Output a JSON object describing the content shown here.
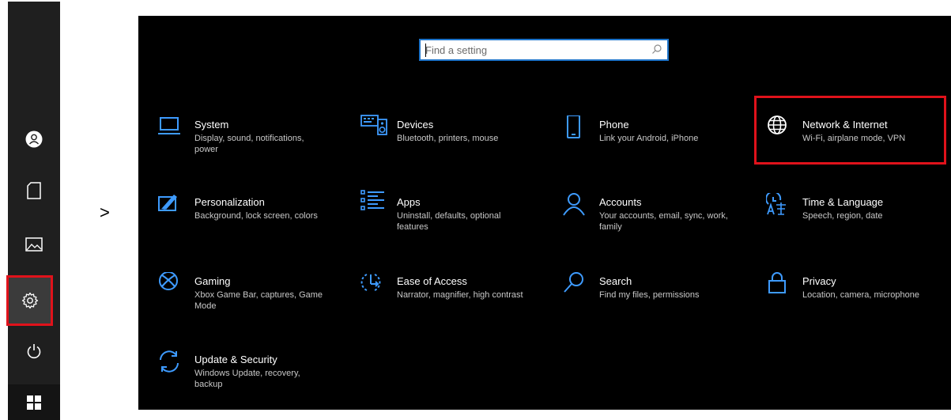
{
  "arrow_text": ">",
  "search": {
    "placeholder": "Find a setting"
  },
  "tiles": [
    {
      "title": "System",
      "desc": "Display, sound, notifications, power",
      "icon": "laptop-icon"
    },
    {
      "title": "Devices",
      "desc": "Bluetooth, printers, mouse",
      "icon": "keyboard-speaker-icon"
    },
    {
      "title": "Phone",
      "desc": "Link your Android, iPhone",
      "icon": "phone-icon"
    },
    {
      "title": "Network & Internet",
      "desc": "Wi-Fi, airplane mode, VPN",
      "icon": "globe-icon"
    },
    {
      "title": "Personalization",
      "desc": "Background, lock screen, colors",
      "icon": "paint-icon"
    },
    {
      "title": "Apps",
      "desc": "Uninstall, defaults, optional features",
      "icon": "apps-list-icon"
    },
    {
      "title": "Accounts",
      "desc": "Your accounts, email, sync, work, family",
      "icon": "person-icon"
    },
    {
      "title": "Time & Language",
      "desc": "Speech, region, date",
      "icon": "time-language-icon"
    },
    {
      "title": "Gaming",
      "desc": "Xbox Game Bar, captures, Game Mode",
      "icon": "xbox-icon"
    },
    {
      "title": "Ease of Access",
      "desc": "Narrator, magnifier, high contrast",
      "icon": "ease-of-access-icon"
    },
    {
      "title": "Search",
      "desc": "Find my files, permissions",
      "icon": "search-icon"
    },
    {
      "title": "Privacy",
      "desc": "Location, camera, microphone",
      "icon": "lock-icon"
    },
    {
      "title": "Update & Security",
      "desc": "Windows Update, recovery, backup",
      "icon": "sync-icon"
    }
  ],
  "colors": {
    "accent": "#1e74c9",
    "icon_blue": "#3e9bff",
    "highlight_red": "#e0121b",
    "window_bg": "#000000"
  }
}
